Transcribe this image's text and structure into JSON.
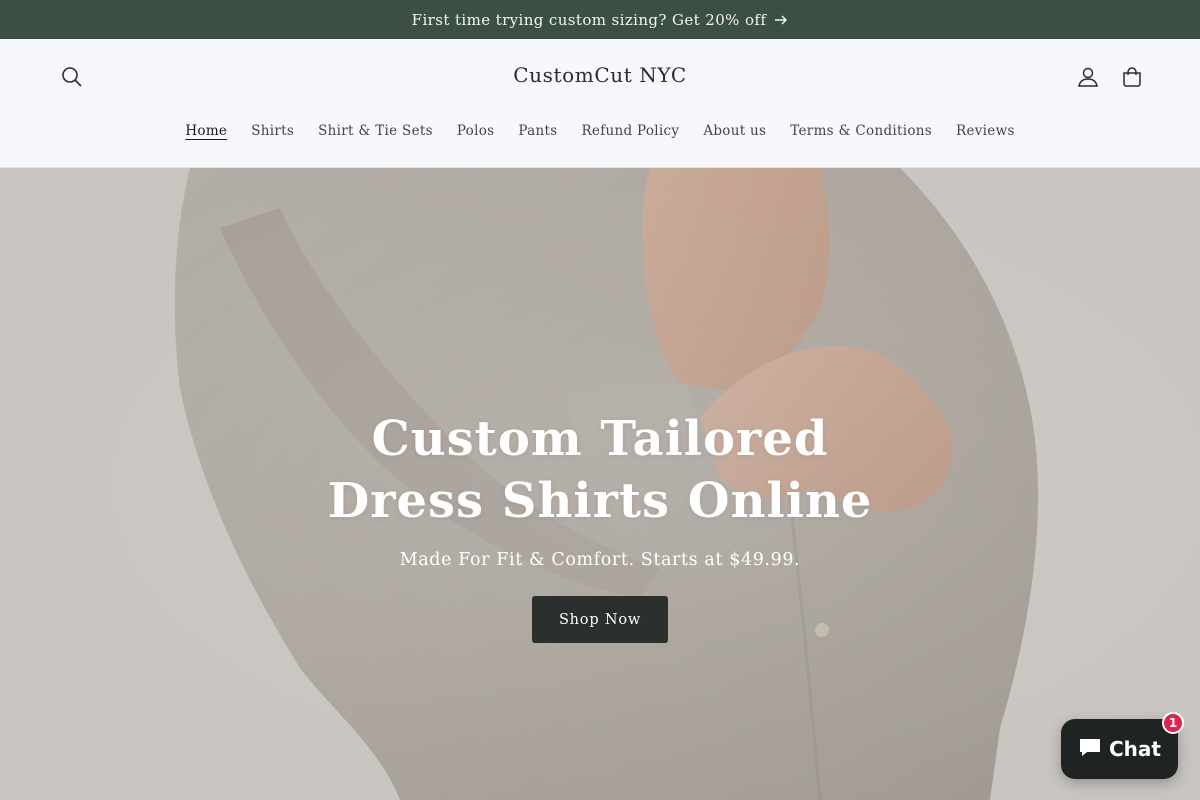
{
  "announcement": {
    "text": "First time trying custom sizing? Get 20% off"
  },
  "header": {
    "logo": "CustomCut NYC",
    "nav": [
      {
        "label": "Home",
        "active": true
      },
      {
        "label": "Shirts"
      },
      {
        "label": "Shirt & Tie Sets"
      },
      {
        "label": "Polos"
      },
      {
        "label": "Pants"
      },
      {
        "label": "Refund Policy"
      },
      {
        "label": "About us"
      },
      {
        "label": "Terms & Conditions"
      },
      {
        "label": "Reviews"
      }
    ],
    "icons": [
      "search-icon",
      "account-icon",
      "cart-icon"
    ]
  },
  "hero": {
    "title": "Custom Tailored Dress Shirts Online",
    "subtitle": "Made For Fit & Comfort. Starts at $49.99.",
    "button": "Shop Now"
  },
  "chat": {
    "label": "Chat",
    "badge": "1"
  },
  "colors": {
    "announcement_bg": "#3c4f45",
    "button_bg": "#2b302e",
    "chat_bg": "#1f2422",
    "badge": "#e0224f"
  }
}
